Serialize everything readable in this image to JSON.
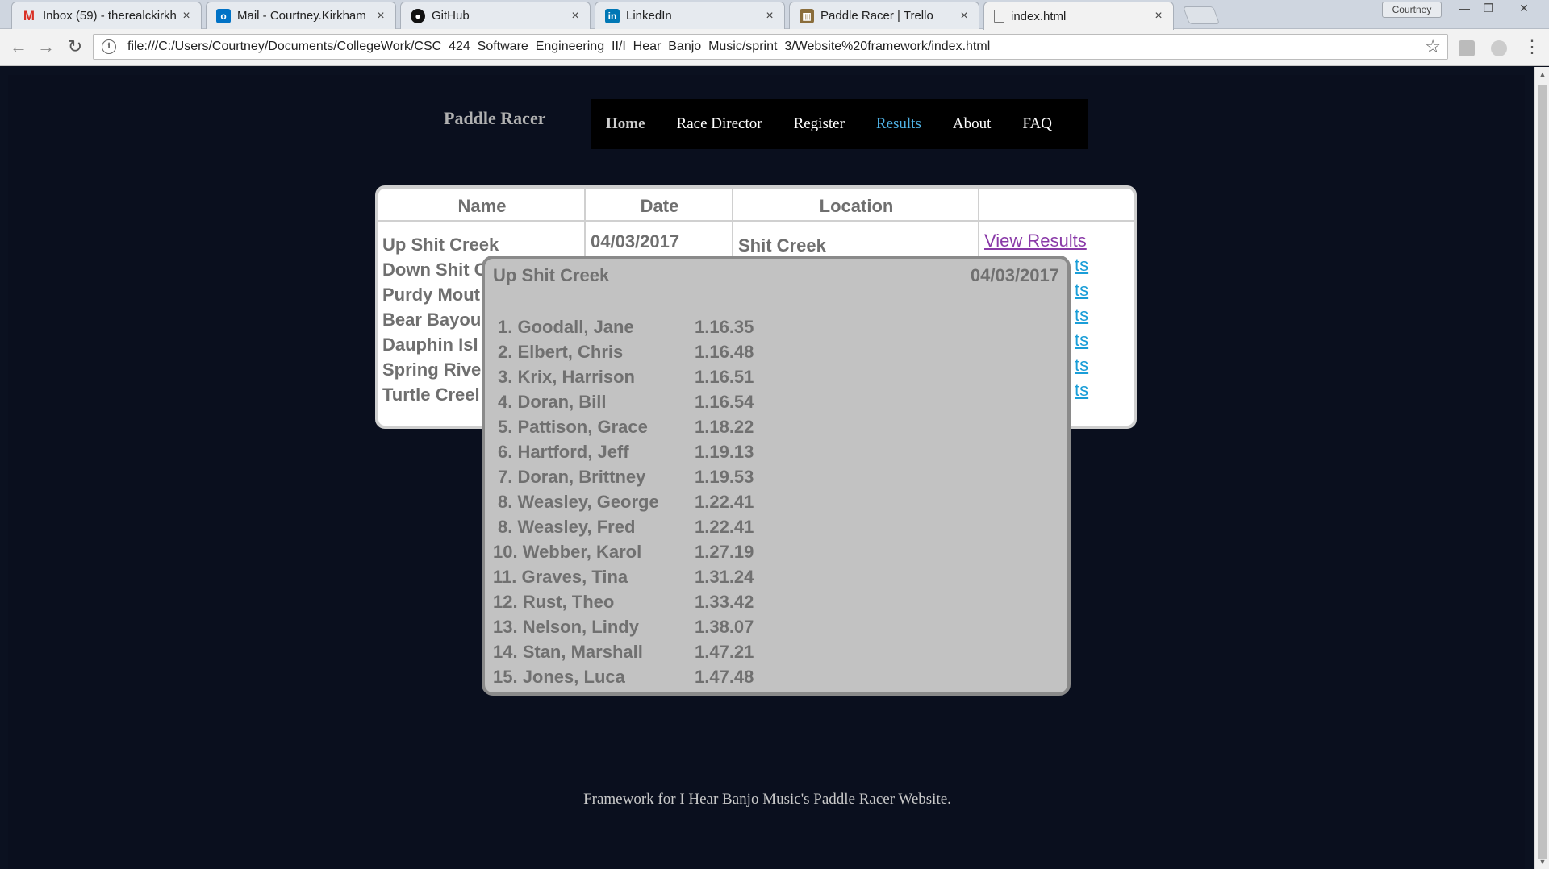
{
  "browser": {
    "tabs": [
      {
        "label": "Inbox (59) - therealckirkh",
        "icon": "gmail-icon",
        "color": "#d93025"
      },
      {
        "label": "Mail - Courtney.Kirkham",
        "icon": "outlook-icon",
        "color": "#0072c6"
      },
      {
        "label": "GitHub",
        "icon": "github-icon",
        "color": "#111111"
      },
      {
        "label": "LinkedIn",
        "icon": "linkedin-icon",
        "color": "#0077b5"
      },
      {
        "label": "Paddle Racer | Trello",
        "icon": "trello-icon",
        "color": "#8a6d3b"
      },
      {
        "label": "index.html",
        "icon": "file-icon",
        "color": "#777777"
      }
    ],
    "profile": "Courtney",
    "url": "file:///C:/Users/Courtney/Documents/CollegeWork/CSC_424_Software_Engineering_II/I_Hear_Banjo_Music/sprint_3/Website%20framework/index.html"
  },
  "site": {
    "brand": "Paddle Racer",
    "nav": [
      "Home",
      "Race Director",
      "Register",
      "Results",
      "About",
      "FAQ"
    ],
    "active_nav": "Results",
    "footer": "Framework for I Hear Banjo Music's Paddle Racer Website."
  },
  "races_table": {
    "headers": {
      "name": "Name",
      "date": "Date",
      "location": "Location",
      "action": ""
    },
    "rows": [
      {
        "name": "Up Shit Creek",
        "date": "04/03/2017",
        "location": "Shit Creek",
        "link": "View Results"
      },
      {
        "name": "Down Shit C",
        "link": "ts"
      },
      {
        "name": "Purdy Mout",
        "link": "ts"
      },
      {
        "name": "Bear Bayou",
        "link": "ts"
      },
      {
        "name": "Dauphin Isl",
        "link": "ts"
      },
      {
        "name": "Spring Rive",
        "link": "ts"
      },
      {
        "name": "Turtle Creel",
        "link": "ts"
      }
    ]
  },
  "results_popup": {
    "title": "Up Shit Creek",
    "date": "04/03/2017",
    "results": [
      {
        "place": "1. Goodall, Jane",
        "time": "1.16.35"
      },
      {
        "place": "2. Elbert, Chris",
        "time": "1.16.48"
      },
      {
        "place": "3. Krix, Harrison",
        "time": "1.16.51"
      },
      {
        "place": "4. Doran, Bill",
        "time": "1.16.54"
      },
      {
        "place": "5. Pattison, Grace",
        "time": "1.18.22"
      },
      {
        "place": "6. Hartford, Jeff",
        "time": "1.19.13"
      },
      {
        "place": "7. Doran, Brittney",
        "time": "1.19.53"
      },
      {
        "place": "8. Weasley, George",
        "time": "1.22.41"
      },
      {
        "place": "8. Weasley, Fred",
        "time": "1.22.41"
      },
      {
        "place": "10. Webber, Karol",
        "time": "1.27.19"
      },
      {
        "place": "11. Graves, Tina",
        "time": "1.31.24"
      },
      {
        "place": "12. Rust, Theo",
        "time": "1.33.42"
      },
      {
        "place": "13. Nelson, Lindy",
        "time": "1.38.07"
      },
      {
        "place": "14. Stan, Marshall",
        "time": "1.47.21"
      },
      {
        "place": "15. Jones, Luca",
        "time": "1.47.48"
      }
    ]
  }
}
